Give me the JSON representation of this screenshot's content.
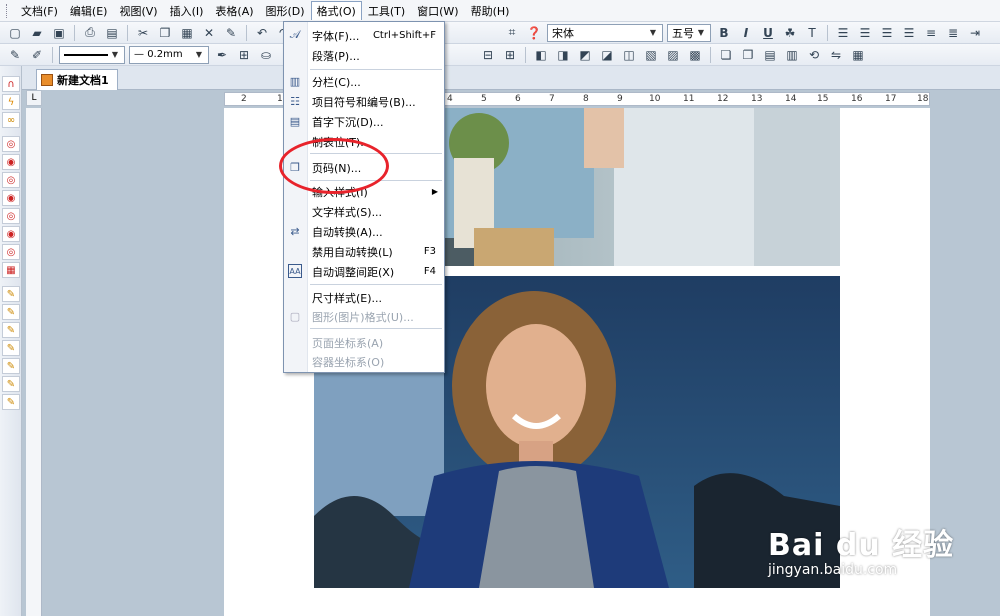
{
  "menubar": {
    "items": [
      "文档(F)",
      "编辑(E)",
      "视图(V)",
      "插入(I)",
      "表格(A)",
      "图形(D)",
      "格式(O)",
      "工具(T)",
      "窗口(W)",
      "帮助(H)"
    ]
  },
  "toolbar": {
    "font_name": "宋体",
    "font_size": "五号",
    "line_width": "0.2mm",
    "bold": "B",
    "italic": "I",
    "underline": "U"
  },
  "tabs": {
    "doc_tab": "新建文档1"
  },
  "ruler": {
    "ticks": [
      "2",
      "1",
      "4",
      "5",
      "6",
      "7",
      "8",
      "9",
      "10",
      "11",
      "12",
      "13",
      "14",
      "15",
      "16",
      "17",
      "18"
    ]
  },
  "format_menu": {
    "items": [
      {
        "label": "字体(F)...",
        "shortcut": "Ctrl+Shift+F",
        "icon": "font-icon"
      },
      {
        "label": "段落(P)...",
        "shortcut": "",
        "icon": ""
      },
      {
        "label": "分栏(C)...",
        "shortcut": "",
        "icon": "columns-icon"
      },
      {
        "label": "项目符号和编号(B)...",
        "shortcut": "",
        "icon": "bullets-icon"
      },
      {
        "label": "首字下沉(D)...",
        "shortcut": "",
        "icon": "dropcap-icon"
      },
      {
        "label": "制表位(T)...",
        "shortcut": "",
        "icon": ""
      },
      {
        "label": "页码(N)...",
        "shortcut": "",
        "icon": "page-number-icon"
      },
      {
        "label": "输入样式(I)",
        "shortcut": "",
        "icon": ""
      },
      {
        "label": "文字样式(S)...",
        "shortcut": "",
        "icon": ""
      },
      {
        "label": "自动转换(A)...",
        "shortcut": "",
        "icon": "auto-convert-icon"
      },
      {
        "label": "禁用自动转换(L)",
        "shortcut": "F3",
        "icon": ""
      },
      {
        "label": "自动调整间距(X)",
        "shortcut": "F4",
        "icon": "spacing-icon"
      },
      {
        "label": "尺寸样式(E)...",
        "shortcut": "",
        "icon": ""
      },
      {
        "label": "图形(图片)格式(U)...",
        "shortcut": "",
        "icon": "picture-format-icon"
      },
      {
        "label": "页面坐标系(A)",
        "shortcut": "",
        "icon": ""
      },
      {
        "label": "容器坐标系(O)",
        "shortcut": "",
        "icon": ""
      }
    ]
  },
  "watermark": {
    "main": "Bai du 经验",
    "sub": "jingyan.baidu.com"
  },
  "colors": {
    "accent": "#e8232b",
    "menu_border": "#7e93b0"
  }
}
